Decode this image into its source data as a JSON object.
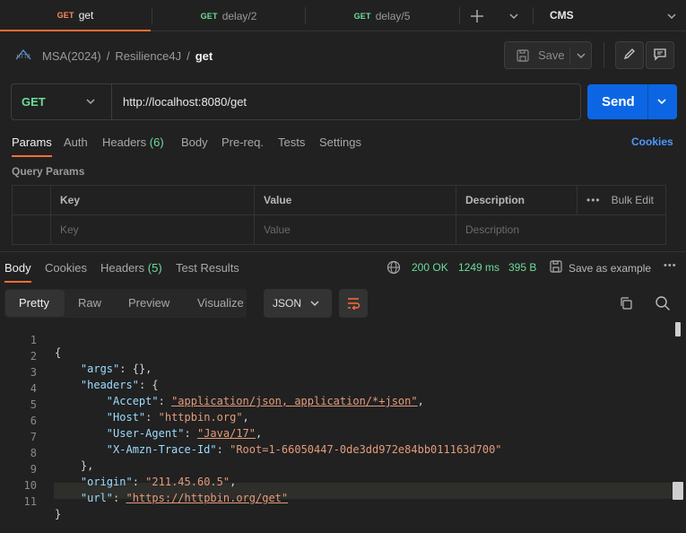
{
  "tabs": [
    {
      "method": "GET",
      "label": "get",
      "active": true
    },
    {
      "method": "GET",
      "label": "delay/2",
      "active": false
    },
    {
      "method": "GET",
      "label": "delay/5",
      "active": false
    }
  ],
  "workspace": "CMS",
  "breadcrumb": {
    "collection": "MSA(2024)",
    "folder": "Resilience4J",
    "request": "get"
  },
  "save_label": "Save",
  "request": {
    "method": "GET",
    "url": "http://localhost:8080/get",
    "send_label": "Send"
  },
  "request_tabs": {
    "params": "Params",
    "auth": "Auth",
    "headers": "Headers",
    "headers_count": "(6)",
    "body": "Body",
    "prereq": "Pre-req.",
    "tests": "Tests",
    "settings": "Settings",
    "cookies": "Cookies"
  },
  "query_params": {
    "title": "Query Params",
    "headers": {
      "key": "Key",
      "value": "Value",
      "description": "Description",
      "bulk_edit": "Bulk Edit"
    },
    "placeholders": {
      "key": "Key",
      "value": "Value",
      "description": "Description"
    }
  },
  "response_tabs": {
    "body": "Body",
    "cookies": "Cookies",
    "headers": "Headers",
    "headers_count": "(5)",
    "test_results": "Test Results"
  },
  "response_meta": {
    "status": "200 OK",
    "time": "1249 ms",
    "size": "395 B",
    "save_example": "Save as example"
  },
  "view_tabs": {
    "pretty": "Pretty",
    "raw": "Raw",
    "preview": "Preview",
    "visualize": "Visualize",
    "format": "JSON"
  },
  "code_lines": [
    {
      "n": "1",
      "text": "{"
    },
    {
      "n": "2",
      "text": "    \"args\": {},"
    },
    {
      "n": "3",
      "text": "    \"headers\": {"
    },
    {
      "n": "4",
      "text": "        \"Accept\": \"application/json, application/*+json\","
    },
    {
      "n": "5",
      "text": "        \"Host\": \"httpbin.org\","
    },
    {
      "n": "6",
      "text": "        \"User-Agent\": \"Java/17\","
    },
    {
      "n": "7",
      "text": "        \"X-Amzn-Trace-Id\": \"Root=1-66050447-0de3dd972e84bb011163d700\""
    },
    {
      "n": "8",
      "text": "    },"
    },
    {
      "n": "9",
      "text": "    \"origin\": \"211.45.60.5\","
    },
    {
      "n": "10",
      "text": "    \"url\": \"https://httpbin.org/get\""
    },
    {
      "n": "11",
      "text": "}"
    }
  ],
  "colors": {
    "accent": "#ff6c37",
    "send": "#0c66e4",
    "method": "#6bdd9a",
    "status": "#6bdd9a",
    "cookies_link": "#4c9aff"
  }
}
